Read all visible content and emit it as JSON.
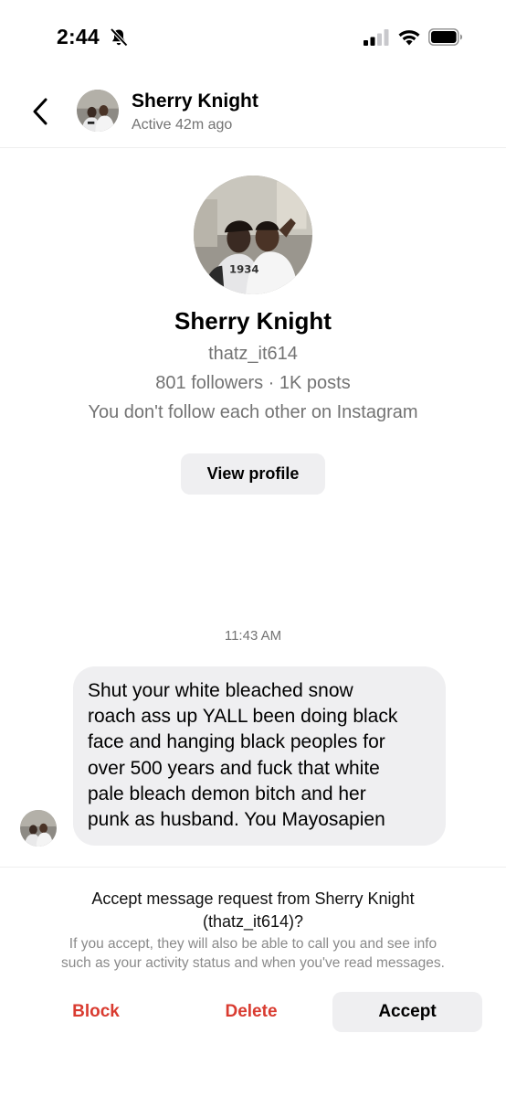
{
  "status_bar": {
    "time": "2:44",
    "icons": [
      "bell-slash-icon",
      "cellular-signal-icon",
      "wifi-icon",
      "battery-icon"
    ]
  },
  "header": {
    "back_icon": "chevron-left-icon",
    "name": "Sherry Knight",
    "status": "Active 42m ago"
  },
  "profile": {
    "name": "Sherry Knight",
    "handle": "thatz_it614",
    "stats": "801 followers · 1K posts",
    "mutual": "You don't follow each other on Instagram",
    "view_profile_label": "View profile"
  },
  "conversation": {
    "timestamp": "11:43 AM",
    "messages": [
      {
        "lines": [
          "Shut your white bleached snow",
          "roach ass up YALL been doing black",
          "face and hanging black peoples for",
          "over 500 years and fuck that white",
          "pale bleach demon bitch and her",
          "punk as husband.  You Mayosapien"
        ]
      }
    ]
  },
  "request": {
    "title_line1": "Accept message request from Sherry Knight",
    "title_line2": "(thatz_it614)?",
    "note_line1": "If you accept, they will also be able to call you and see info",
    "note_line2": "such as your activity status and when you've read messages.",
    "block_label": "Block",
    "delete_label": "Delete",
    "accept_label": "Accept"
  },
  "colors": {
    "destructive": "#d93b30",
    "secondary_text": "#737373",
    "bubble_bg": "#efeff1"
  }
}
